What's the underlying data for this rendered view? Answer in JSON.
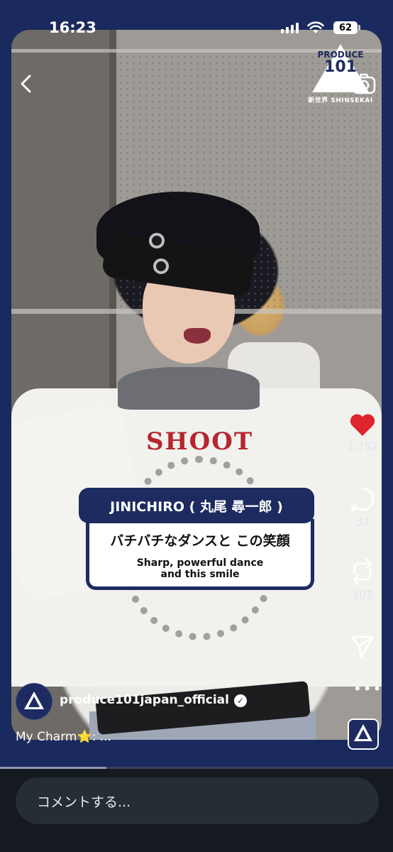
{
  "status_bar": {
    "time": "16:23",
    "battery": "62"
  },
  "logo": {
    "line1": "PRODUCE",
    "line2": "101",
    "line3": "新世界 SHINSEKAI"
  },
  "video": {
    "shirt_print": "SHOOT",
    "progress": 0.27
  },
  "caption_card": {
    "name": "JINICHIRO ( 丸尾 尋一郎 )",
    "jp": "バチバチなダンスと この笑顔",
    "en_line1": "Sharp, powerful dance",
    "en_line2": "and this smile"
  },
  "actions": {
    "likes": "1,752",
    "comments": "33",
    "reposts": "107",
    "like_color": "#e0242e"
  },
  "post": {
    "username": "produce101japan_official",
    "caption": "My Charm⭐️: ..."
  },
  "comment_input": {
    "placeholder": "コメントする..."
  },
  "icons": [
    "back-icon",
    "camera-icon",
    "heart-icon",
    "comment-icon",
    "repost-icon",
    "send-icon",
    "more-icon",
    "verified-icon"
  ]
}
